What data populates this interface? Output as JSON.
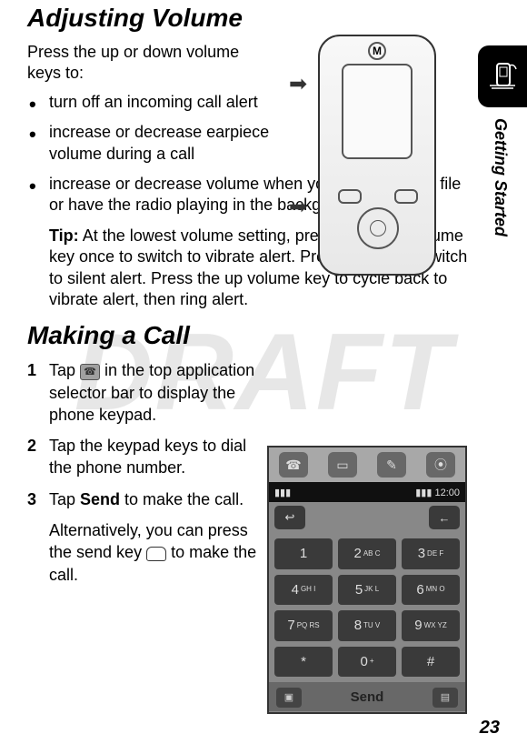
{
  "watermark": "DRAFT",
  "side_tab": {
    "icon": "phone-hand-icon",
    "label": "Getting Started"
  },
  "section1": {
    "title": "Adjusting Volume",
    "intro": "Press the up or down volume keys to:",
    "bullets": [
      "turn off an incoming call alert",
      "increase or decrease earpiece volume during a call",
      "increase or decrease volume when you play an audio file or have the radio playing in the background"
    ],
    "tip_label": "Tip:",
    "tip": "At the lowest volume setting, press the down volume key once to switch to vibrate alert. Press it again to switch to silent alert. Press the up volume key to cycle back to vibrate alert, then ring alert."
  },
  "section2": {
    "title": "Making a Call",
    "steps": [
      {
        "prefix": "Tap ",
        "icon": "phone-app-icon",
        "suffix": " in the top application selector bar to display the phone keypad."
      },
      {
        "text": "Tap the keypad keys to dial the phone number."
      },
      {
        "prefix": "Tap ",
        "bold": "Send",
        "suffix": " to make the call.",
        "followup_prefix": "Alternatively, you can press the send key ",
        "followup_icon": "send-key-icon",
        "followup_suffix": " to make the call."
      }
    ]
  },
  "keypad": {
    "status_time": "12:00",
    "keys": [
      "1",
      "2",
      "3",
      "4",
      "5",
      "6",
      "7",
      "8",
      "9",
      "*",
      "0",
      "#"
    ],
    "key_letters": [
      "",
      "AB C",
      "DE F",
      "GH I",
      "JK L",
      "MN O",
      "PQ RS",
      "TU V",
      "WX YZ",
      "",
      "+",
      ""
    ],
    "send": "Send"
  },
  "page_number": "23"
}
